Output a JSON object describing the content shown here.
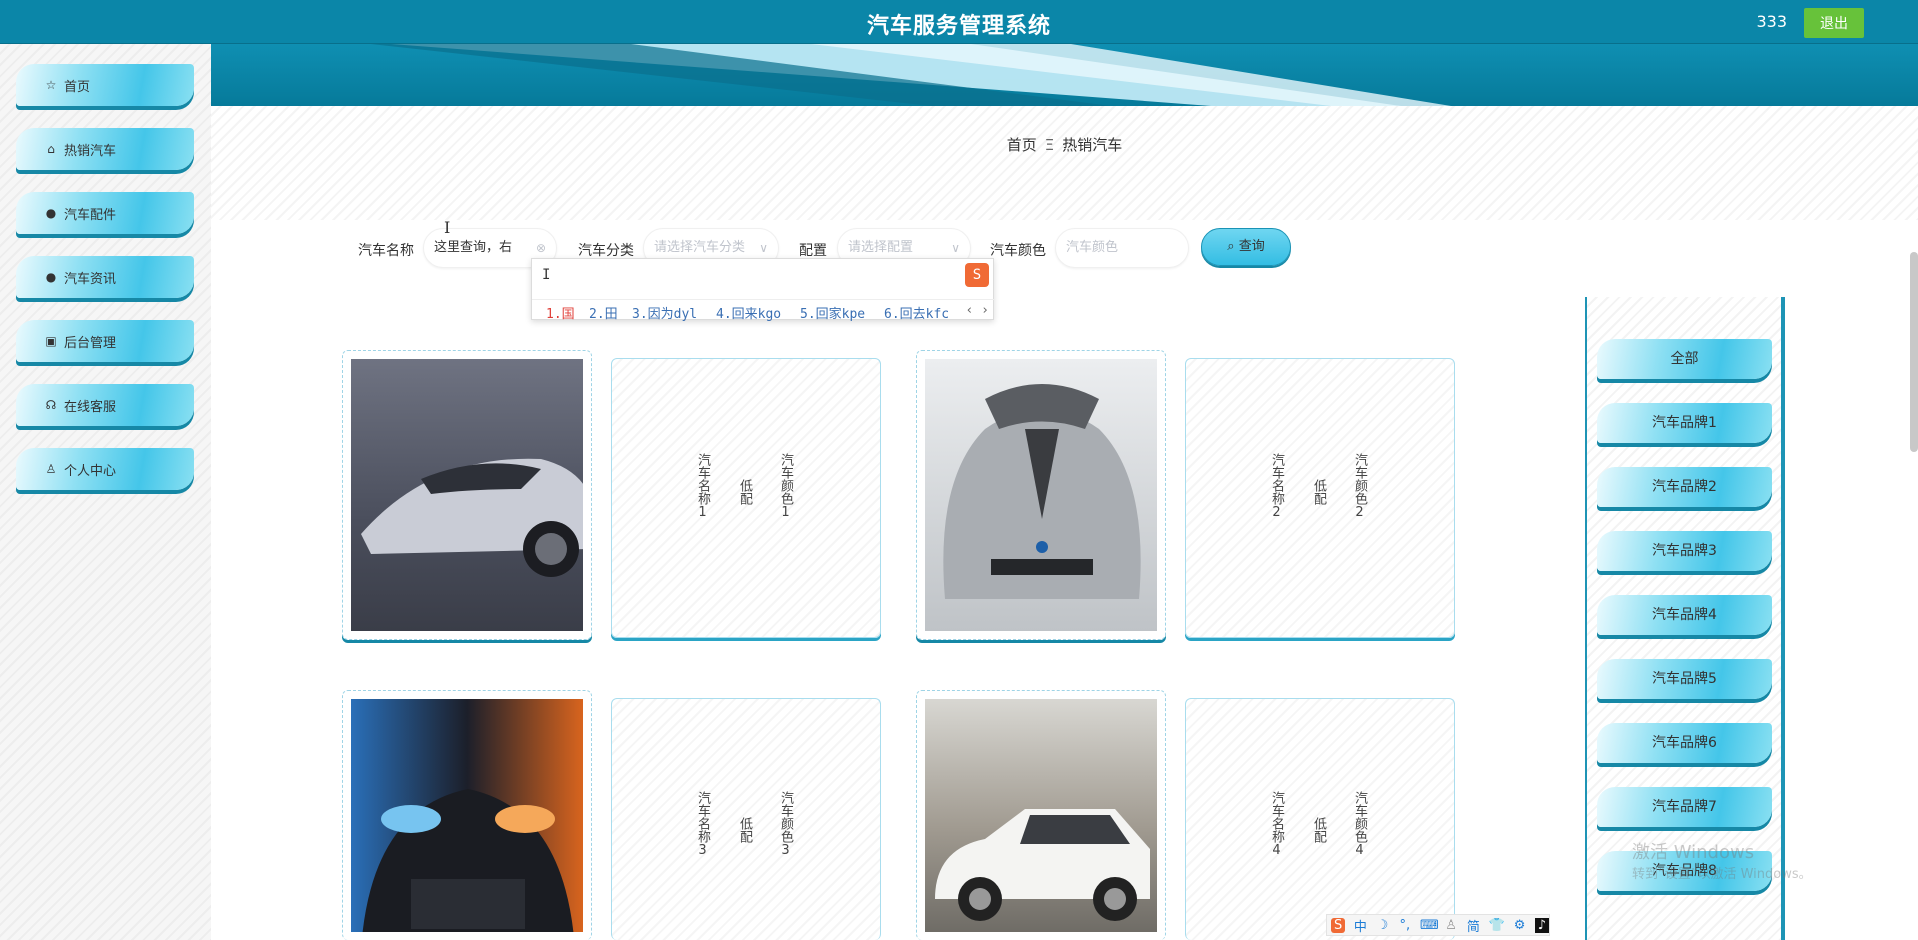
{
  "header": {
    "title": "汽车服务管理系统",
    "user": "333",
    "logout_label": "退出"
  },
  "sidebar": {
    "items": [
      {
        "label": "首页",
        "icon": "☆"
      },
      {
        "label": "热销汽车",
        "icon": "⌂"
      },
      {
        "label": "汽车配件",
        "icon": "●"
      },
      {
        "label": "汽车资讯",
        "icon": "●"
      },
      {
        "label": "后台管理",
        "icon": "▣"
      },
      {
        "label": "在线客服",
        "icon": "☊"
      },
      {
        "label": "个人中心",
        "icon": "♙"
      }
    ]
  },
  "breadcrumb": {
    "home": "首页",
    "separator": "Ξ",
    "current": "热销汽车"
  },
  "search": {
    "name_label": "汽车名称",
    "name_value": "这里查询，右",
    "category_label": "汽车分类",
    "category_placeholder": "请选择汽车分类",
    "config_label": "配置",
    "config_placeholder": "请选择配置",
    "color_label": "汽车颜色",
    "color_placeholder": "汽车颜色",
    "query_label": "查询"
  },
  "ime": {
    "typed": "I",
    "candidates": [
      "1.国",
      "2.田",
      "3.因为dyl",
      "4.回来kgo",
      "5.回家kpe",
      "6.回去kfc"
    ]
  },
  "cars": [
    {
      "name": "汽车名称1",
      "config": "低配",
      "color": "汽车颜色1"
    },
    {
      "name": "汽车名称2",
      "config": "低配",
      "color": "汽车颜色2"
    },
    {
      "name": "汽车名称3",
      "config": "低配",
      "color": "汽车颜色3"
    },
    {
      "name": "汽车名称4",
      "config": "低配",
      "color": "汽车颜色4"
    }
  ],
  "brands": [
    "全部",
    "汽车品牌1",
    "汽车品牌2",
    "汽车品牌3",
    "汽车品牌4",
    "汽车品牌5",
    "汽车品牌6",
    "汽车品牌7",
    "汽车品牌8"
  ],
  "watermark": {
    "line1": "激活 Windows",
    "line2": "转到“设置”以激活 Windows。"
  },
  "tray": [
    "中",
    "☽",
    "°,",
    "⌨",
    "♙",
    "简",
    "👕",
    "⚙",
    "♪"
  ],
  "colors": {
    "accent": "#0b86a8",
    "logout": "#67c23a",
    "button_shadow": "#1688a6"
  }
}
